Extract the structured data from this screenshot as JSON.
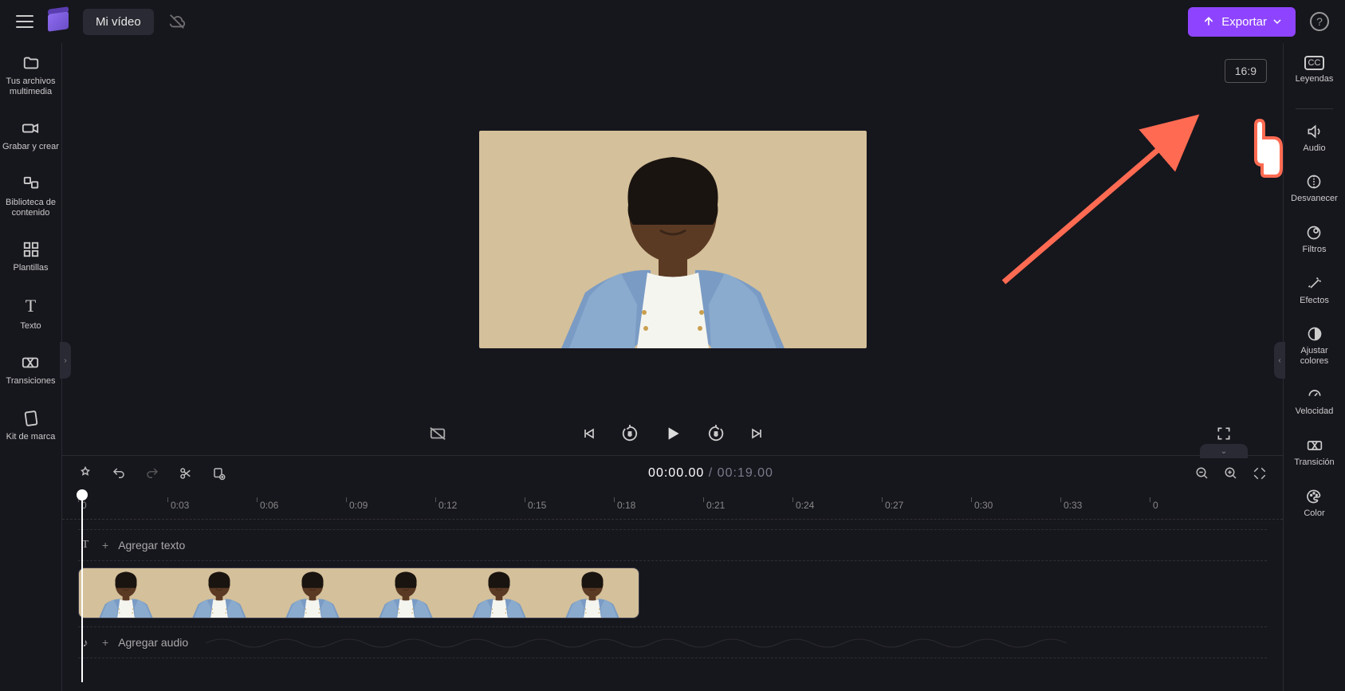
{
  "header": {
    "title": "Mi vídeo",
    "export_label": "Exportar"
  },
  "preview": {
    "ratio": "16:9"
  },
  "timeline": {
    "current": "00:00.00",
    "duration": "00:19.00",
    "ticks": [
      "0",
      "0:03",
      "0:06",
      "0:09",
      "0:12",
      "0:15",
      "0:18",
      "0:21",
      "0:24",
      "0:27",
      "0:30",
      "0:33",
      "0"
    ],
    "tracks": {
      "text": {
        "label": "Agregar texto"
      },
      "audio": {
        "label": "Agregar audio"
      }
    }
  },
  "left_sidebar": [
    {
      "icon": "folder",
      "label": "Tus archivos multimedia"
    },
    {
      "icon": "camera",
      "label": "Grabar y crear"
    },
    {
      "icon": "library",
      "label": "Biblioteca de contenido"
    },
    {
      "icon": "templates",
      "label": "Plantillas"
    },
    {
      "icon": "text",
      "label": "Texto"
    },
    {
      "icon": "transitions",
      "label": "Transiciones"
    },
    {
      "icon": "brand",
      "label": "Kit de marca"
    }
  ],
  "right_sidebar": [
    {
      "icon": "cc",
      "label": "Leyendas"
    },
    {
      "icon": "audio",
      "label": "Audio"
    },
    {
      "icon": "fade",
      "label": "Desvanecer"
    },
    {
      "icon": "filters",
      "label": "Filtros"
    },
    {
      "icon": "effects",
      "label": "Efectos"
    },
    {
      "icon": "adjust",
      "label": "Ajustar colores"
    },
    {
      "icon": "speed",
      "label": "Velocidad"
    },
    {
      "icon": "transition",
      "label": "Transición"
    },
    {
      "icon": "color",
      "label": "Color"
    }
  ]
}
